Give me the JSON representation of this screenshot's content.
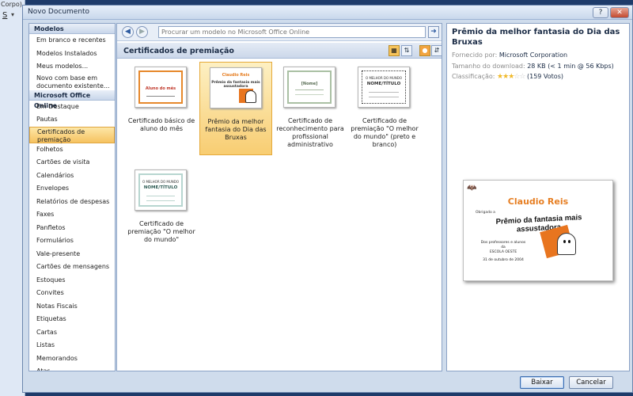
{
  "background": {
    "ribbon_text": "Corpo)",
    "font_button": "S",
    "font_arrow": "▾"
  },
  "dialog": {
    "title": "Novo Documento",
    "help_label": "?",
    "close_label": "✕"
  },
  "left_panel": {
    "section_models": "Modelos",
    "models_items": [
      "Em branco e recentes",
      "Modelos Instalados",
      "Meus modelos...",
      "Novo com base em documento existente..."
    ],
    "section_online": "Microsoft Office Online",
    "online_items": [
      "Em Destaque",
      "Pautas",
      "Certificados de premiação",
      "Folhetos",
      "Cartões de visita",
      "Calendários",
      "Envelopes",
      "Relatórios de despesas",
      "Faxes",
      "Panfletos",
      "Formulários",
      "Vale-presente",
      "Cartões de mensagens",
      "Estoques",
      "Convites",
      "Notas Fiscais",
      "Etiquetas",
      "Cartas",
      "Listas",
      "Memorandos",
      "Atas"
    ],
    "selected_item": "Certificados de premiação"
  },
  "middle_panel": {
    "search_placeholder": "Procurar um modelo no Microsoft Office Online",
    "category_title": "Certificados de premiação",
    "templates": [
      {
        "label": "Certificado básico de aluno do mês",
        "thumb_text": "Aluno do mês",
        "selected": false
      },
      {
        "label": "Prêmio da melhor fantasia do Dia das Bruxas",
        "thumb_text": "Claudio Reis",
        "thumb_sub": "Prêmio da fantasia mais assustadora",
        "selected": true
      },
      {
        "label": "Certificado de reconhecimento para profissional administrativo",
        "thumb_text": "[Nome]",
        "selected": false
      },
      {
        "label": "Certificado de premiação \"O melhor do mundo\" (preto e branco)",
        "thumb_text": "NOME/TÍTULO",
        "thumb_sub": "O MELHOR DO MUNDO",
        "selected": false
      },
      {
        "label": "Certificado de premiação \"O melhor do mundo\"",
        "thumb_text": "NOME/TÍTULO",
        "thumb_sub": "O MELHOR DO MUNDO",
        "selected": false
      }
    ]
  },
  "right_panel": {
    "title": "Prêmio da melhor fantasia do Dia das Bruxas",
    "provided_by_label": "Fornecido por:",
    "provided_by": "Microsoft Corporation",
    "download_size_label": "Tamanho do download:",
    "download_size": "28 KB (< 1 min @ 56 Kbps)",
    "rating_label": "Classificação:",
    "rating_stars": 3,
    "rating_max": 5,
    "votes": "(159 Votos)",
    "preview": {
      "name": "Claudio Reis",
      "small1": "Obrigado a",
      "award": "Prêmio da fantasia mais assustadora",
      "line1": "Dos professores e alunos",
      "line2": "da",
      "line3": "ESCOLA OESTE",
      "date": "31 de outubro de 2004"
    }
  },
  "buttons": {
    "download": "Baixar",
    "cancel": "Cancelar"
  },
  "colors": {
    "dialog_bg": "#cfdcec",
    "selected_bg": "#f8cd72",
    "accent_orange": "#e67e22",
    "title_text": "#1b2c46"
  },
  "icons": [
    "back-arrow-icon",
    "forward-arrow-icon",
    "go-arrow-icon",
    "view-thumbnail-icon",
    "sort-icon",
    "person-icon",
    "close-icon",
    "help-icon",
    "star-icon"
  ]
}
